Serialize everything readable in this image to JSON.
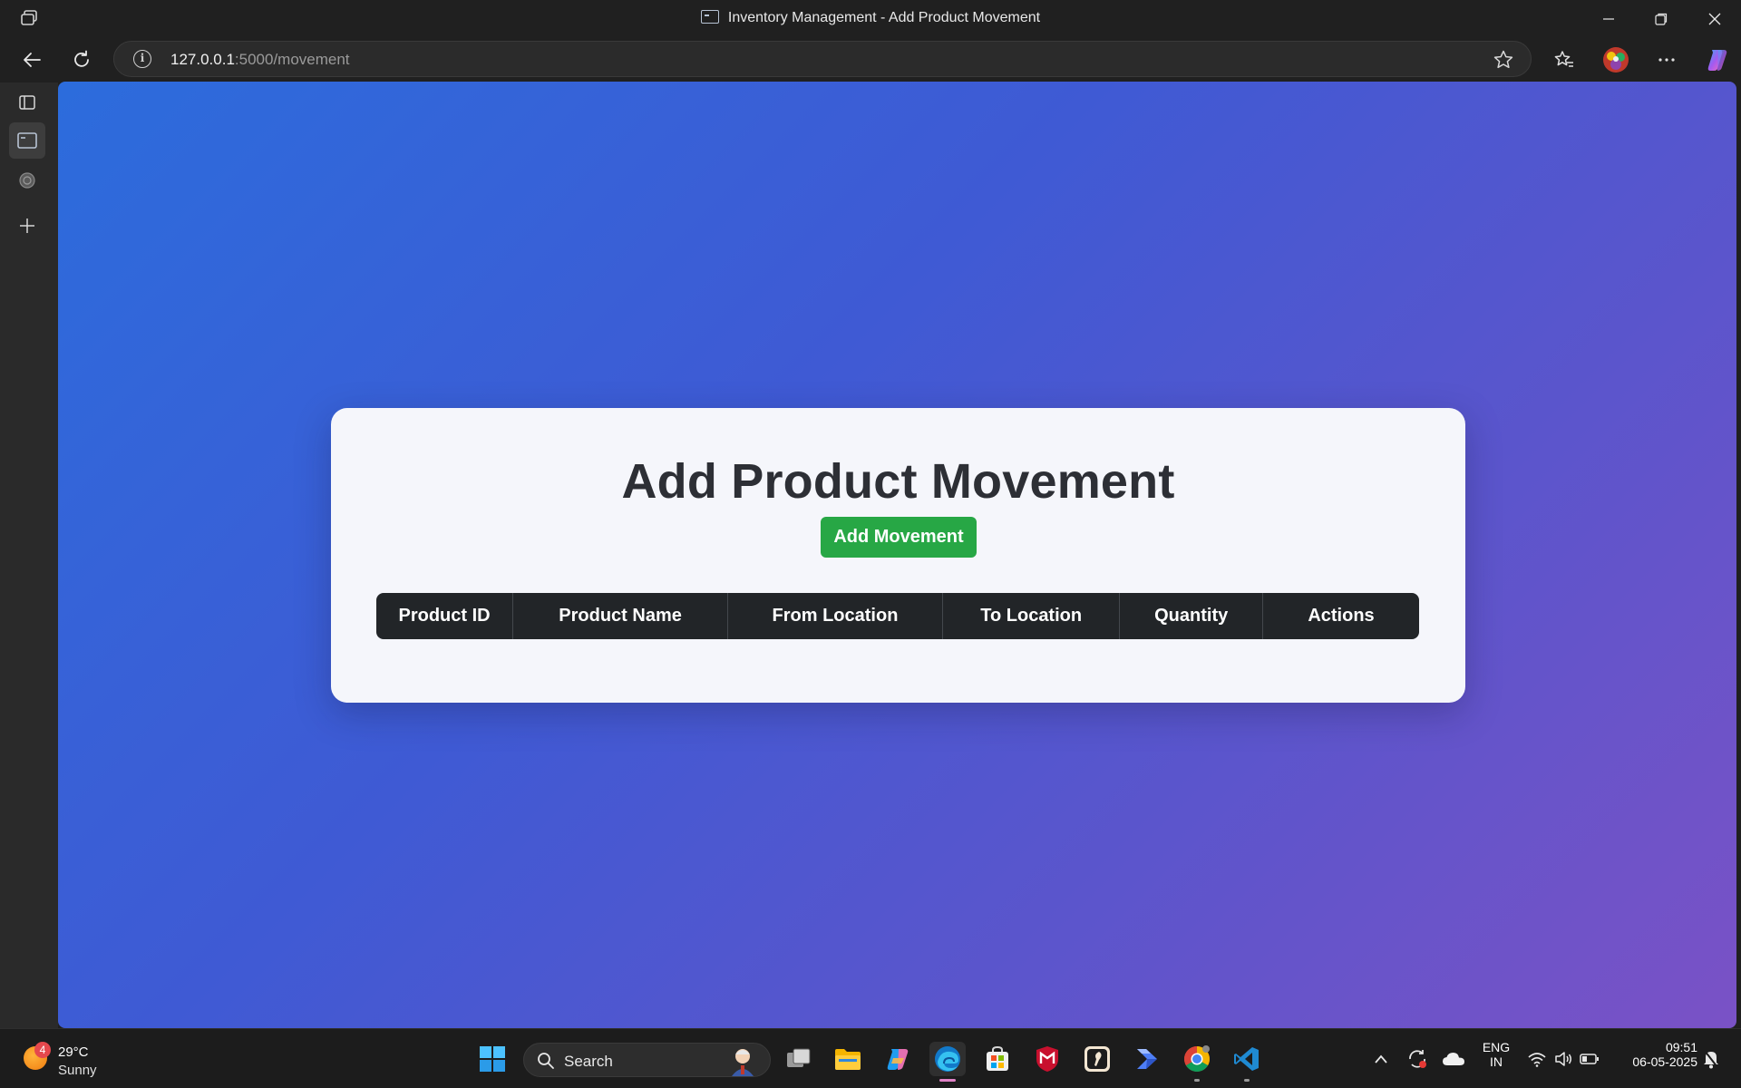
{
  "window": {
    "title": "Inventory Management - Add Product Movement"
  },
  "address_bar": {
    "url_host": "127.0.0.1",
    "url_path": ":5000/movement"
  },
  "page": {
    "heading": "Add Product Movement",
    "add_button_label": "Add Movement",
    "table": {
      "columns": [
        "Product ID",
        "Product Name",
        "From Location",
        "To Location",
        "Quantity",
        "Actions"
      ],
      "rows": []
    }
  },
  "taskbar": {
    "weather": {
      "badge": "4",
      "temperature": "29°C",
      "condition": "Sunny"
    },
    "search_label": "Search",
    "tray": {
      "language_line1": "ENG",
      "language_line2": "IN",
      "time": "09:51",
      "date": "06-05-2025"
    }
  },
  "colors": {
    "accent_green": "#27a745",
    "table_header_bg": "#222528",
    "gradient_start": "#2c6cdc",
    "gradient_end": "#7a52c6"
  }
}
